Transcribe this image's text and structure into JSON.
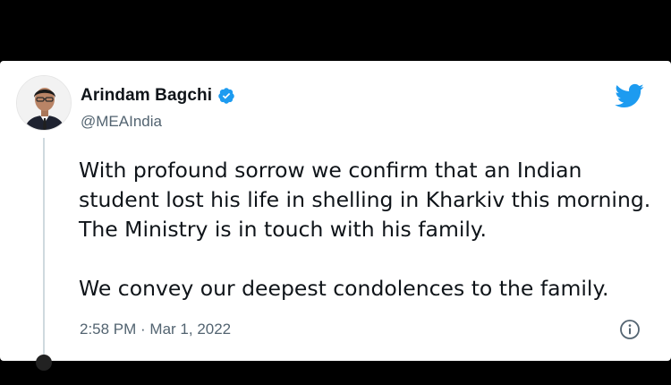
{
  "tweet": {
    "author": {
      "display_name": "Arindam Bagchi",
      "handle": "@MEAIndia",
      "verified": true
    },
    "text": [
      "With profound sorrow we confirm that an Indian student lost his life in shelling in Kharkiv this morning. The Ministry is in touch with his family.",
      "We convey our deepest condolences to the family."
    ],
    "timestamp": "2:58 PM · Mar 1, 2022",
    "icons": {
      "brand": "twitter-bird-icon",
      "verified": "verified-badge-icon",
      "info": "info-icon"
    }
  },
  "colors": {
    "twitter_blue": "#1d9bf0",
    "text_primary": "#0f1419",
    "text_secondary": "#536471",
    "background": "#000000",
    "card": "#ffffff"
  }
}
